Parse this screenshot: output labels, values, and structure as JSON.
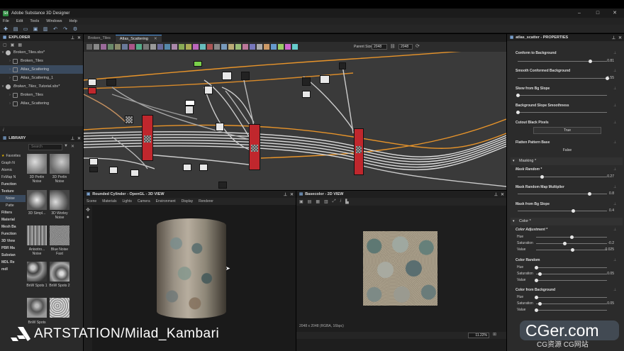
{
  "window": {
    "title": "Adobe Substance 3D Designer",
    "app_icon": "Sd",
    "controls": [
      "–",
      "□",
      "✕"
    ]
  },
  "menu": [
    "File",
    "Edit",
    "Tools",
    "Windows",
    "Help"
  ],
  "explorer": {
    "title": "EXPLORER",
    "packages": [
      {
        "name": "Broken_Tiles.sbs*",
        "graphs": [
          "Broken_Tiles",
          "Atlas_Scattering",
          "Atlas_Scattering_1"
        ]
      },
      {
        "name": "Broken_Tiles_Tutorial.sbs*",
        "graphs": [
          "Broken_Tiles",
          "Atlas_Scattering"
        ]
      }
    ]
  },
  "library": {
    "title": "LIBRARY",
    "search_placeholder": "Search",
    "categories": [
      "Favorites",
      "Graph N",
      "Atomic",
      "FxMap N",
      "Function",
      "Texture",
      "Noise",
      "Patte",
      "Filters",
      "Material",
      "Mesh Ba",
      "Function",
      "3D View",
      "PBR Ma",
      "Substan",
      "MDL Re",
      "mdl"
    ],
    "thumbs": [
      {
        "label": "3D Perlin Noise"
      },
      {
        "label": "3D Perlin Noise"
      },
      {
        "label": "3D Simpl..."
      },
      {
        "label": "3D Worley Noise"
      },
      {
        "label": "Anisotro... Noise"
      },
      {
        "label": "Blue Noise Fast"
      },
      {
        "label": "BnW Spots 1"
      },
      {
        "label": "BnW Spots 2"
      },
      {
        "label": "BnW Spots"
      },
      {
        "label": ""
      }
    ]
  },
  "graph": {
    "tabs": [
      "Broken_Tiles",
      "Atlas_Scattering"
    ],
    "parent_size_label": "Parent Size:",
    "parent_size": "2048",
    "size2": "2048"
  },
  "view3d": {
    "title": "Rounded Cylinder - OpenGL - 3D VIEW",
    "menu": [
      "Scene",
      "Materials",
      "Lights",
      "Camera",
      "Environment",
      "Display",
      "Renderer"
    ]
  },
  "view2d": {
    "title": "Basecolor - 2D VIEW",
    "info": "2048 x 2048 (RGBA, 16bpc)",
    "zoom": "11.22%"
  },
  "properties": {
    "title": "atlas_scatter - PROPERTIES",
    "items": [
      {
        "label": "Conform to Background",
        "value": "0.81",
        "frac": 0.81
      },
      {
        "label": "Smooth Conformed Background",
        "value": "1.55",
        "frac": 1.0
      },
      {
        "label": "Skew from Bg Slope",
        "value": "",
        "frac": 0.0
      },
      {
        "label": "Background Slope Smoothness",
        "value": "",
        "frac": 0.0
      }
    ],
    "cutout_label": "Cutout Black Pixels",
    "cutout_value": "True",
    "flatten_label": "Flatten Pattern Base",
    "flatten_value": "False",
    "masking_title": "Masking *",
    "masking": [
      {
        "label": "Mask Random *",
        "value": "0.27",
        "frac": 0.27
      },
      {
        "label": "Mask Random Map Multiplier",
        "value": "0.8",
        "frac": 0.8
      },
      {
        "label": "Mask from Bg Slope",
        "value": "0.4",
        "frac": 0.62
      }
    ],
    "color_title": "Color *",
    "color_groups": [
      {
        "label": "Color Adjustment *",
        "rows": [
          {
            "name": "Hue",
            "value": "0",
            "frac": 0.5
          },
          {
            "name": "Saturation",
            "value": "-0.2",
            "frac": 0.4
          },
          {
            "name": "Value",
            "value": "0.025",
            "frac": 0.51
          }
        ]
      },
      {
        "label": "Color Random",
        "rows": [
          {
            "name": "Hue",
            "value": "0",
            "frac": 0.0
          },
          {
            "name": "Saturation",
            "value": "0.05",
            "frac": 0.05
          },
          {
            "name": "Value",
            "value": "0",
            "frac": 0.0
          }
        ]
      },
      {
        "label": "Color from Background",
        "rows": [
          {
            "name": "Hue",
            "value": "0",
            "frac": 0.0
          },
          {
            "name": "Saturation",
            "value": "0.05",
            "frac": 0.05
          },
          {
            "name": "Value",
            "value": "0",
            "frac": 0.0
          }
        ]
      }
    ]
  },
  "watermarks": {
    "artstation": "ARTSTATION/Milad_Kambari",
    "cger": "CGer.com",
    "cger_sub": "CG资源 CG网站"
  },
  "colors": {
    "accent": "#4a90d9",
    "node_red": "#c0272d",
    "wire_orange": "#e8942a"
  }
}
